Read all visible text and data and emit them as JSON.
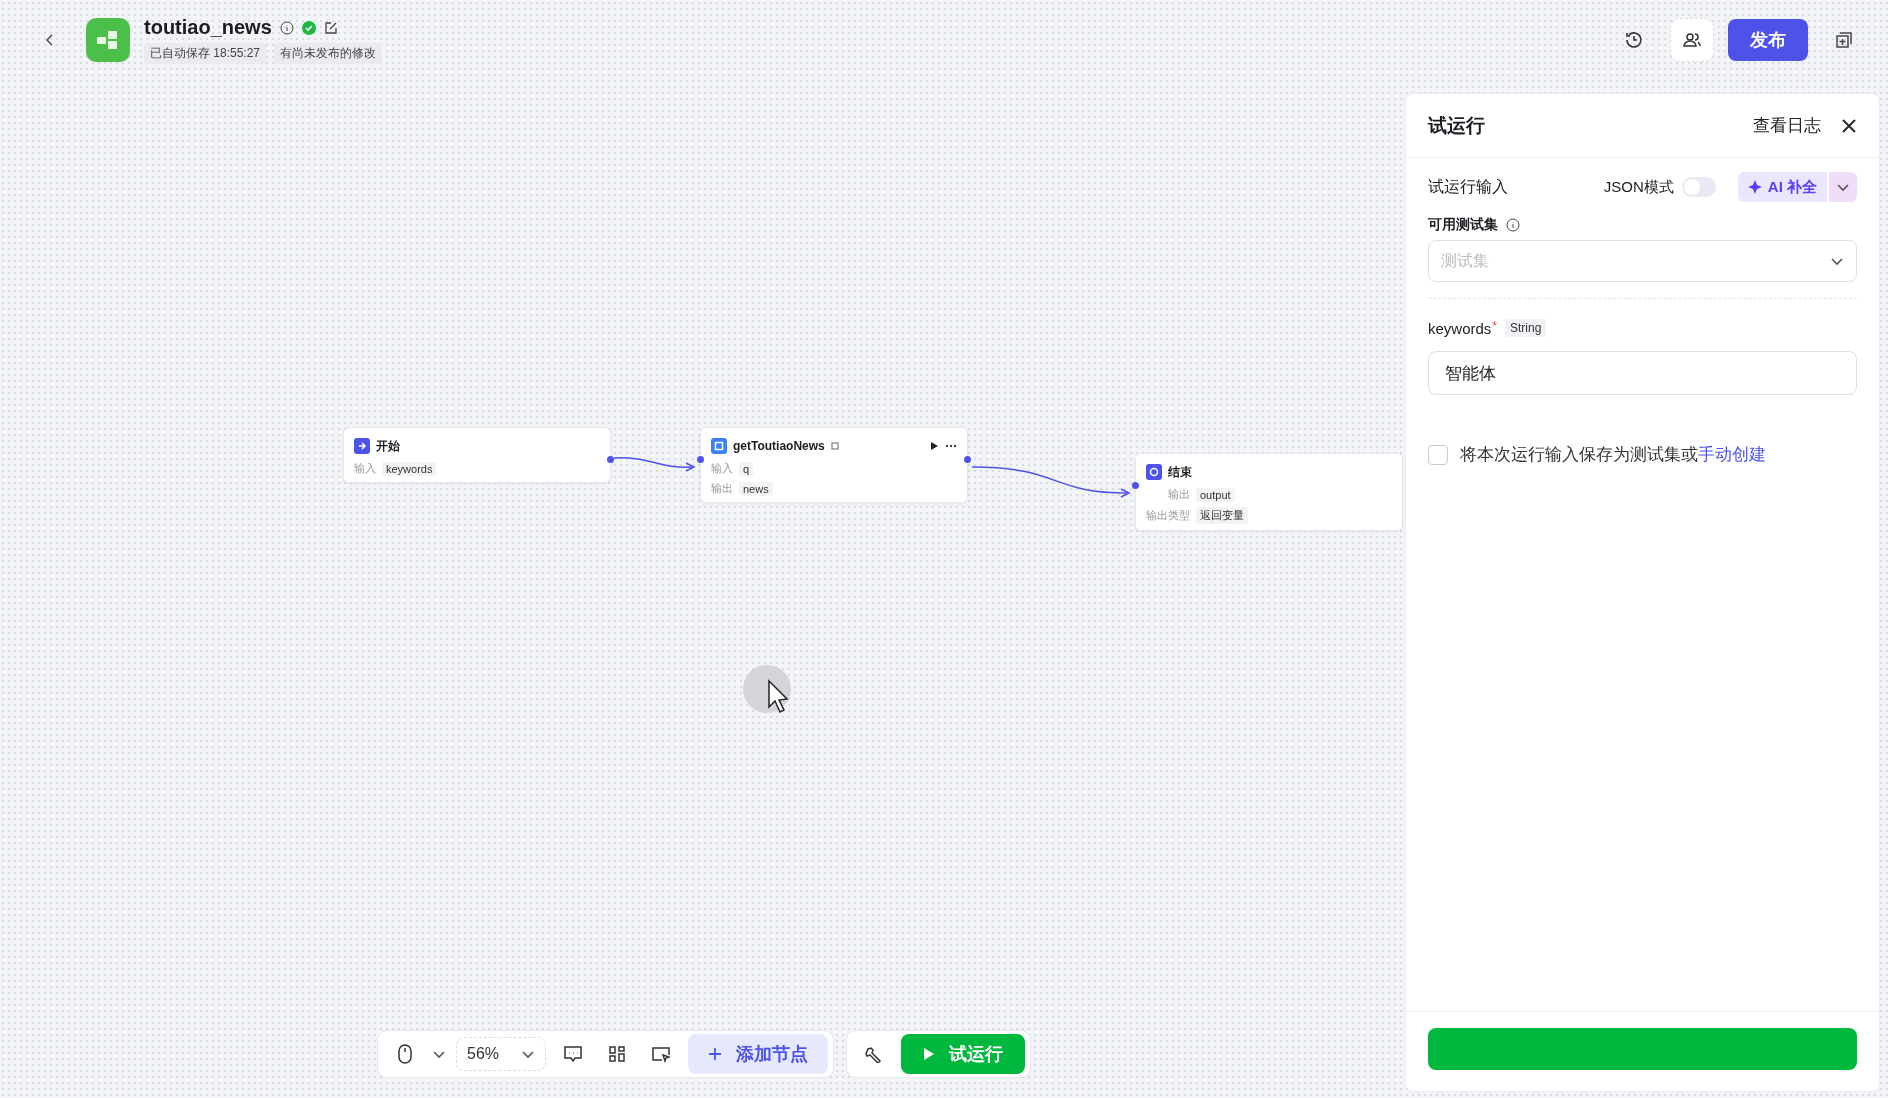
{
  "header": {
    "title": "toutiao_news",
    "autosave": "已自动保存 18:55:27",
    "unpublished": "有尚未发布的修改",
    "publish_button": "发布"
  },
  "nodes": [
    {
      "kind": "start",
      "title": "开始",
      "rows": [
        {
          "label": "输入",
          "value": "keywords"
        }
      ]
    },
    {
      "kind": "plugin",
      "title": "getToutiaoNews",
      "rows": [
        {
          "label": "输入",
          "value": "q"
        },
        {
          "label": "输出",
          "value": "news"
        }
      ]
    },
    {
      "kind": "end",
      "title": "结束",
      "rows": [
        {
          "label": "输出",
          "value": "output"
        },
        {
          "label": "输出类型",
          "value": "返回变量"
        }
      ]
    }
  ],
  "toolbar": {
    "zoom": "56%",
    "add_node": "添加节点",
    "run": "试运行"
  },
  "panel": {
    "title": "试运行",
    "log_link": "查看日志",
    "section": "试运行输入",
    "json_mode": {
      "label": "JSON模式",
      "on": false
    },
    "ai_button": "AI 补全",
    "testset_label": "可用测试集",
    "testset_placeholder": "测试集",
    "param": {
      "name": "keywords",
      "required_mark": "*",
      "type": "String",
      "value": "智能体"
    },
    "save_option": {
      "label": "将本次运行输入保存为测试集或",
      "link": "手动创建",
      "checked": false
    }
  }
}
